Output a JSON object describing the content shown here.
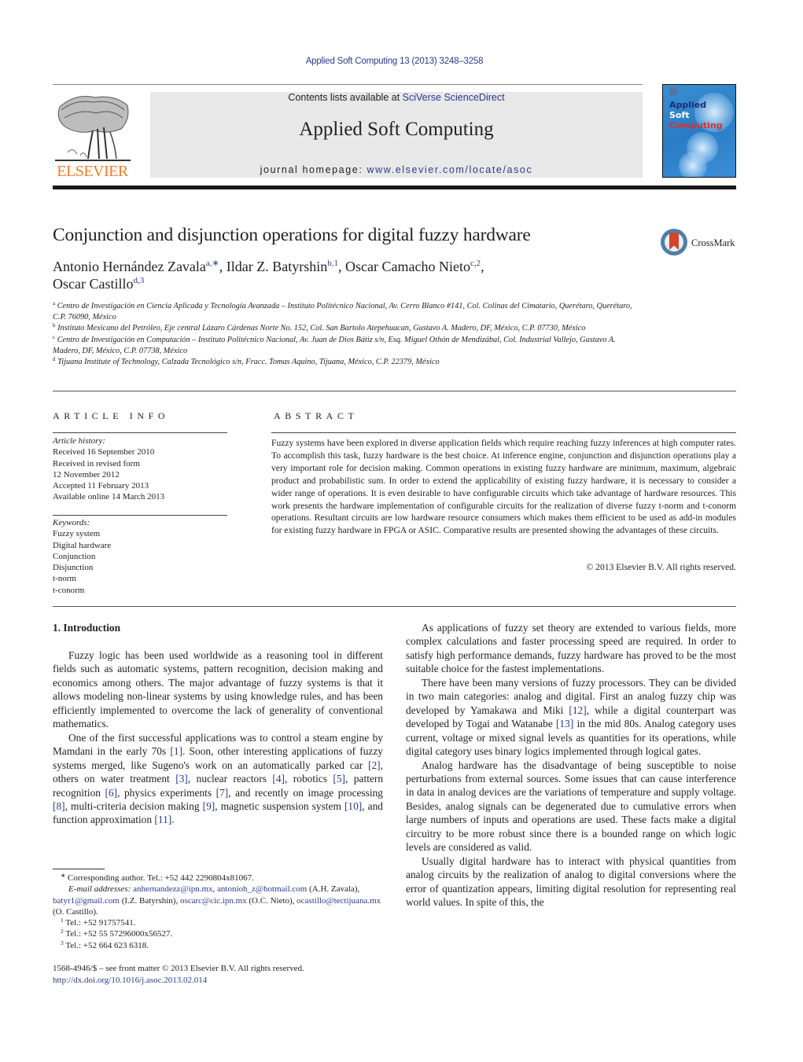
{
  "header": {
    "journal_ref": "Applied Soft Computing 13 (2013) 3248–3258",
    "contents_prefix": "Contents lists available at ",
    "contents_link": "SciVerse ScienceDirect",
    "journal_name": "Applied Soft Computing",
    "homepage_prefix": "journal homepage: ",
    "homepage_link": "www.elsevier.com/locate/asoc",
    "publisher_logo_text": "ELSEVIER",
    "cover": {
      "line1": "Applied",
      "line2": "Soft",
      "line3": "Computing"
    },
    "colors": {
      "link": "#2b3a8c",
      "elsevier_orange": "#f07c24",
      "cover_blue": "#2a7cc4",
      "cover_red": "#d8322a"
    }
  },
  "article": {
    "title": "Conjunction and disjunction operations for digital fuzzy hardware",
    "crossmark_label": "CrossMark",
    "authors": [
      {
        "name": "Antonio Hernández Zavala",
        "sup": "a,∗",
        "sep": ", "
      },
      {
        "name": "Ildar Z. Batyrshin",
        "sup": "b,1",
        "sep": ", "
      },
      {
        "name": "Oscar Camacho Nieto",
        "sup": "c,2",
        "sep": ","
      },
      {
        "name": "Oscar Castillo",
        "sup": "d,3",
        "sep": ""
      }
    ],
    "affiliations": [
      {
        "mark": "a",
        "text": "Centro de Investigación en Ciencia Aplicada y Tecnología Avanzada – Instituto Politécnico Nacional, Av. Cerro Blanco #141, Col. Colinas del Cimatario, Querétaro, Querétaro, C.P. 76090, México"
      },
      {
        "mark": "b",
        "text": "Instituto Mexicano del Petróleo, Eje central Lázaro Cárdenas Norte No. 152, Col. San Bartolo Atepehuacan, Gustavo A. Madero, DF, México, C.P. 07730, México"
      },
      {
        "mark": "c",
        "text": "Centro de Investigación en Computación – Instituto Politécnico Nacional, Av. Juan de Dios Bátiz s/n, Esq. Miguel Othón de Mendizábal, Col. Industrial Vallejo, Gustavo A. Madero, DF, México, C.P. 07738, México"
      },
      {
        "mark": "d",
        "text": "Tijuana Institute of Technology, Calzada Tecnológico s/n, Fracc. Tomas Aquino, Tijuana, México, C.P. 22379, México"
      }
    ]
  },
  "article_info": {
    "heading": "ARTICLE INFO",
    "history_label": "Article history:",
    "history": [
      "Received 16 September 2010",
      "Received in revised form",
      "12 November 2012",
      "Accepted 11 February 2013",
      "Available online 14 March 2013"
    ],
    "keywords_label": "Keywords:",
    "keywords": [
      "Fuzzy system",
      "Digital hardware",
      "Conjunction",
      "Disjunction",
      "t-norm",
      "t-conorm"
    ]
  },
  "abstract": {
    "heading": "ABSTRACT",
    "text": "Fuzzy systems have been explored in diverse application fields which require reaching fuzzy inferences at high computer rates. To accomplish this task, fuzzy hardware is the best choice. At inference engine, conjunction and disjunction operations play a very important role for decision making. Common operations in existing fuzzy hardware are minimum, maximum, algebraic product and probabilistic sum. In order to extend the applicability of existing fuzzy hardware, it is necessary to consider a wider range of operations. It is even desirable to have configurable circuits which take advantage of hardware resources. This work presents the hardware implementation of configurable circuits for the realization of diverse fuzzy t-norm and t-conorm operations. Resultant circuits are low hardware resource consumers which makes them efficient to be used as add-in modules for existing fuzzy hardware in FPGA or ASIC. Comparative results are presented showing the advantages of these circuits.",
    "copyright": "© 2013 Elsevier B.V. All rights reserved."
  },
  "body": {
    "section_heading": "1.  Introduction",
    "left_paragraphs": [
      [
        {
          "t": "Fuzzy logic has been used worldwide as a reasoning tool in different fields such as automatic systems, pattern recognition, decision making and economics among others. The major advantage of fuzzy systems is that it allows modeling non-linear systems by using knowledge rules, and has been efficiently implemented to overcome the lack of generality of conventional mathematics."
        }
      ],
      [
        {
          "t": "One of the first successful applications was to control a steam engine by Mamdani in the early 70s "
        },
        {
          "ref": "[1]"
        },
        {
          "t": ". Soon, other interesting applications of fuzzy systems merged, like Sugeno's work on an automatically parked car "
        },
        {
          "ref": "[2]"
        },
        {
          "t": ", others on water treatment "
        },
        {
          "ref": "[3]"
        },
        {
          "t": ", nuclear reactors "
        },
        {
          "ref": "[4]"
        },
        {
          "t": ", robotics "
        },
        {
          "ref": "[5]"
        },
        {
          "t": ", pattern recognition "
        },
        {
          "ref": "[6]"
        },
        {
          "t": ", physics experiments "
        },
        {
          "ref": "[7]"
        },
        {
          "t": ", and recently on image processing "
        },
        {
          "ref": "[8]"
        },
        {
          "t": ", multi-criteria decision making "
        },
        {
          "ref": "[9]"
        },
        {
          "t": ", magnetic suspension system "
        },
        {
          "ref": "[10]"
        },
        {
          "t": ", and function approximation "
        },
        {
          "ref": "[11]"
        },
        {
          "t": "."
        }
      ]
    ],
    "right_paragraphs": [
      [
        {
          "t": "As applications of fuzzy set theory are extended to various fields, more complex calculations and faster processing speed are required. In order to satisfy high performance demands, fuzzy hardware has proved to be the most suitable choice for the fastest implementations."
        }
      ],
      [
        {
          "t": "There have been many versions of fuzzy processors. They can be divided in two main categories: analog and digital. First an analog fuzzy chip was developed by Yamakawa and Miki "
        },
        {
          "ref": "[12]"
        },
        {
          "t": ", while a digital counterpart was developed by Togai and Watanabe "
        },
        {
          "ref": "[13]"
        },
        {
          "t": " in the mid 80s. Analog category uses current, voltage or mixed signal levels as quantities for its operations, while digital category uses binary logics implemented through logical gates."
        }
      ],
      [
        {
          "t": "Analog hardware has the disadvantage of being susceptible to noise perturbations from external sources. Some issues that can cause interference in data in analog devices are the variations of temperature and supply voltage. Besides, analog signals can be degenerated due to cumulative errors when large numbers of inputs and operations are used. These facts make a digital circuitry to be more robust since there is a bounded range on which logic levels are considered as valid."
        }
      ],
      [
        {
          "t": "Usually digital hardware has to interact with physical quantities from analog circuits by the realization of analog to digital conversions where the error of quantization appears, limiting digital resolution for representing real world values. In spite of this, the"
        }
      ]
    ]
  },
  "footnotes": {
    "corresponding": "Corresponding author. Tel.: +52 442 2290804x81067.",
    "corresponding_mark": "∗",
    "email_label": "E-mail addresses:",
    "emails": [
      {
        "addr": "anhernandezz@ipn.mx",
        "after": ", "
      },
      {
        "addr": "antonioh_z@hotmail.com",
        "after": " (A.H. Zavala), "
      },
      {
        "addr": "batyr1@gmail.com",
        "after": " (I.Z. Batyrshin), "
      },
      {
        "addr": "oscarc@cic.ipn.mx",
        "after": " (O.C. Nieto), "
      },
      {
        "addr": "ocastillo@tectijuana.mx",
        "after": " (O. Castillo)."
      }
    ],
    "tels": [
      {
        "mark": "1",
        "text": "Tel.: +52 91757541."
      },
      {
        "mark": "2",
        "text": "Tel.: +52 55 57296000x56527."
      },
      {
        "mark": "3",
        "text": "Tel.: +52 664 623 6318."
      }
    ],
    "front_matter": "1568-4946/$ – see front matter © 2013 Elsevier B.V. All rights reserved.",
    "doi": "http://dx.doi.org/10.1016/j.asoc.2013.02.014"
  }
}
